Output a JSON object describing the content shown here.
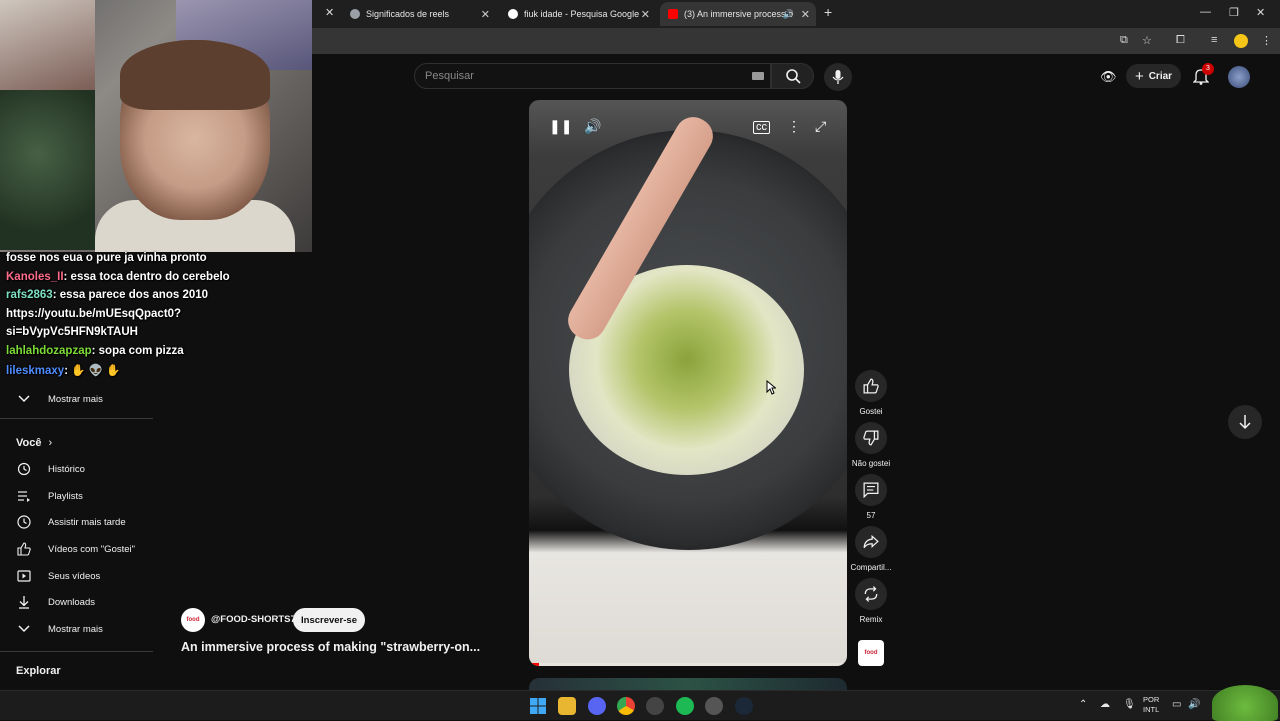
{
  "browser": {
    "tabs": [
      {
        "label": "Significados de reels"
      },
      {
        "label": "fiuk idade - Pesquisa Google"
      },
      {
        "label": "(3) An immersive process o"
      }
    ],
    "new_tab": "+",
    "close": "✕"
  },
  "chat": {
    "lines": [
      {
        "user": "",
        "message": "fosse nos eua o pure ja vinha pronto",
        "color": "#ffffff"
      },
      {
        "user": "Kanoles_II",
        "message": ": essa toca dentro do cerebelo",
        "color": "#ff6b8a"
      },
      {
        "user": "rafs2863",
        "message": ": essa parece dos anos 2010",
        "color": "#7ee0c3"
      },
      {
        "user": "",
        "message": "https://youtu.be/mUEsqQpact0?",
        "color": "#ffffff"
      },
      {
        "user": "",
        "message": "si=bVypVc5HFN9kTAUH",
        "color": "#ffffff"
      },
      {
        "user": "lahlahdozapzap",
        "message": ": sopa com pizza",
        "color": "#7ddc35"
      },
      {
        "user": "lileskmaxy",
        "message": ": ✋ 👽 ✋",
        "color": "#4f8cff"
      }
    ]
  },
  "sidebar": {
    "more_1": "Mostrar mais",
    "you_heading": "Você",
    "items": [
      {
        "label": "Histórico"
      },
      {
        "label": "Playlists"
      },
      {
        "label": "Assistir mais tarde"
      },
      {
        "label": "Vídeos com \"Gostei\""
      },
      {
        "label": "Seus vídeos"
      },
      {
        "label": "Downloads"
      },
      {
        "label": "Mostrar mais"
      }
    ],
    "explore_heading": "Explorar"
  },
  "header": {
    "search_placeholder": "Pesquisar",
    "create_label": "Criar",
    "notification_count": "3"
  },
  "video": {
    "progress": 0.03,
    "channel_name": "@FOOD-SHORTS7",
    "channel_avatar_text": "food",
    "subscribe_label": "Inscrever-se",
    "title": "An immersive process of making \"strawberry-on..."
  },
  "actions": {
    "like": "Gostei",
    "dislike": "Não gostei",
    "comments": "57",
    "share": "Compartil...",
    "remix": "Remix"
  },
  "taskbar": {
    "lang_1": "POR",
    "lang_2": "INTL"
  }
}
